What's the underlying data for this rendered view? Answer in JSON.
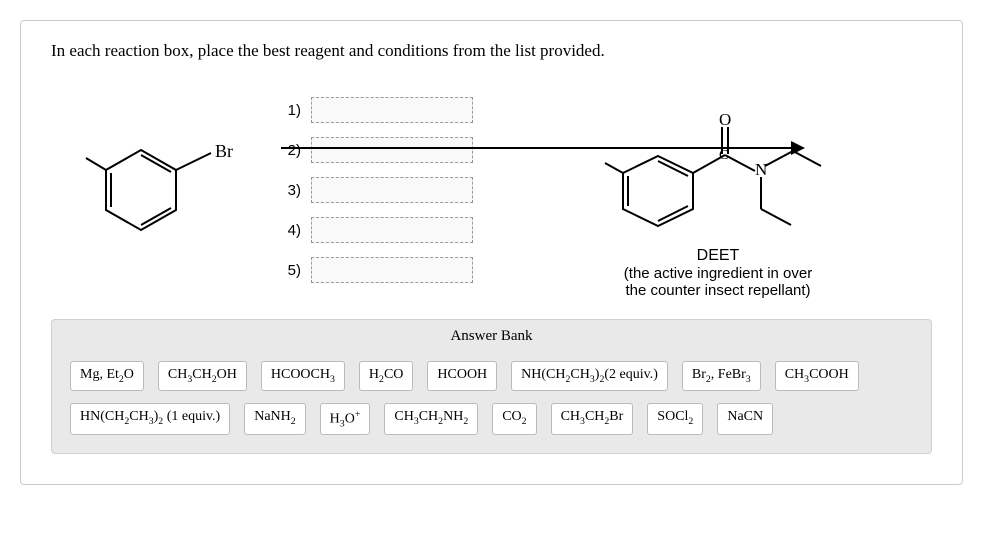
{
  "prompt": "In each reaction box, place the best reagent and conditions from the list provided.",
  "reactant_label": "Br",
  "steps": [
    "1)",
    "2)",
    "3)",
    "4)",
    "5)"
  ],
  "product": {
    "name": "DEET",
    "desc1": "(the active ingredient in over",
    "desc2": "the counter insect repellant)",
    "atom_O": "O",
    "atom_N": "N"
  },
  "bank": {
    "title": "Answer Bank",
    "row1": [
      {
        "html": "Mg, Et<sub>2</sub>O"
      },
      {
        "html": "CH<sub>3</sub>CH<sub>2</sub>OH"
      },
      {
        "html": "HCOOCH<sub>3</sub>"
      },
      {
        "html": "H<sub>2</sub>CO"
      },
      {
        "html": "HCOOH"
      },
      {
        "html": "NH(CH<sub>2</sub>CH<sub>3</sub>)<sub>2</sub>(2 equiv.)"
      },
      {
        "html": "Br<sub>2</sub>, FeBr<sub>3</sub>"
      },
      {
        "html": "CH<sub>3</sub>COOH"
      }
    ],
    "row2": [
      {
        "html": "HN(CH<sub>2</sub>CH<sub>3</sub>)<sub>2</sub> (1 equiv.)"
      },
      {
        "html": "NaNH<sub>2</sub>"
      },
      {
        "html": "H<sub>3</sub>O<sup>+</sup>"
      },
      {
        "html": "CH<sub>3</sub>CH<sub>2</sub>NH<sub>2</sub>"
      },
      {
        "html": "CO<sub>2</sub>"
      },
      {
        "html": "CH<sub>3</sub>CH<sub>2</sub>Br"
      },
      {
        "html": "SOCl<sub>2</sub>"
      },
      {
        "html": "NaCN"
      }
    ]
  }
}
